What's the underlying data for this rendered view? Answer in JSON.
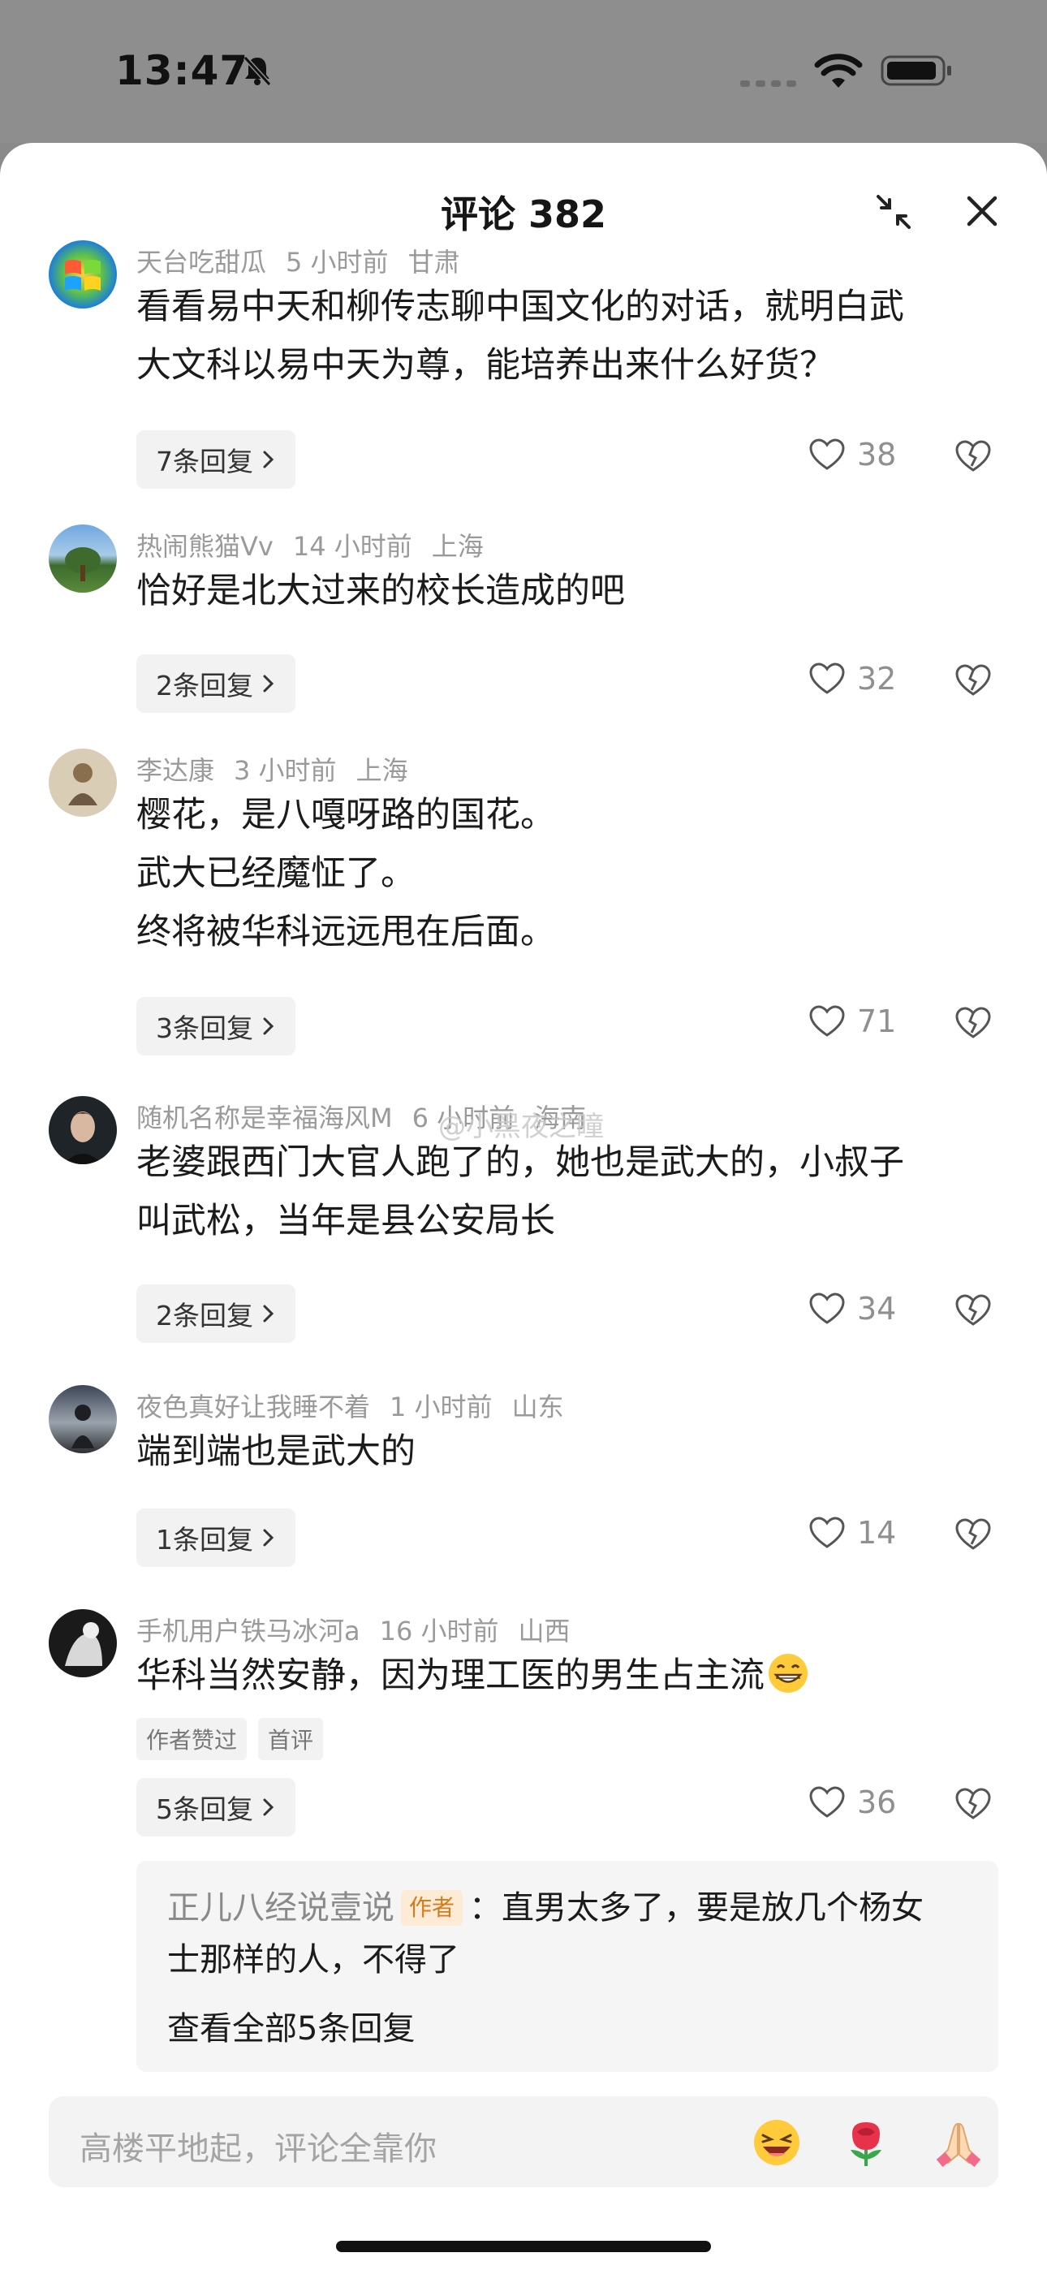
{
  "status": {
    "time": "13:47"
  },
  "header": {
    "title": "评论 382"
  },
  "comments": [
    {
      "user": "天台吃甜瓜",
      "time": "5 小时前",
      "location": "甘肃",
      "lines": [
        "看看易中天和柳传志聊中国文化的对话，就明白武",
        "大文科以易中天为尊，能培养出来什么好货？"
      ],
      "replies": "7条回复",
      "likes": "38"
    },
    {
      "user": "热闹熊猫Vv",
      "time": "14 小时前",
      "location": "上海",
      "lines": [
        "恰好是北大过来的校长造成的吧"
      ],
      "replies": "2条回复",
      "likes": "32"
    },
    {
      "user": "李达康",
      "time": "3 小时前",
      "location": "上海",
      "lines": [
        "樱花，是八嘎呀路的国花。",
        "武大已经魔怔了。",
        "终将被华科远远甩在后面。"
      ],
      "replies": "3条回复",
      "likes": "71"
    },
    {
      "user": "随机名称是幸福海风M",
      "time": "6 小时前",
      "location": "海南",
      "lines": [
        "老婆跟西门大官人跑了的，她也是武大的，小叔子",
        "叫武松，当年是县公安局长"
      ],
      "replies": "2条回复",
      "likes": "34"
    },
    {
      "user": "夜色真好让我睡不着",
      "time": "1 小时前",
      "location": "山东",
      "lines": [
        "端到端也是武大的"
      ],
      "replies": "1条回复",
      "likes": "14"
    },
    {
      "user": "手机用户铁马冰河a",
      "time": "16 小时前",
      "location": "山西",
      "lines": [
        "华科当然安静，因为理工医的男生占主流"
      ],
      "tags": [
        "作者赞过",
        "首评"
      ],
      "replies": "5条回复",
      "likes": "36",
      "subreply": {
        "author": "正儿八经说壹说",
        "badge": "作者",
        "text1": "：直男太多了，要是放几个杨女",
        "text2": "士那样的人，不得了",
        "view_all": "查看全部5条回复"
      }
    }
  ],
  "watermark": "@小黑夜之瞳",
  "input": {
    "placeholder": "高楼平地起，评论全靠你"
  }
}
